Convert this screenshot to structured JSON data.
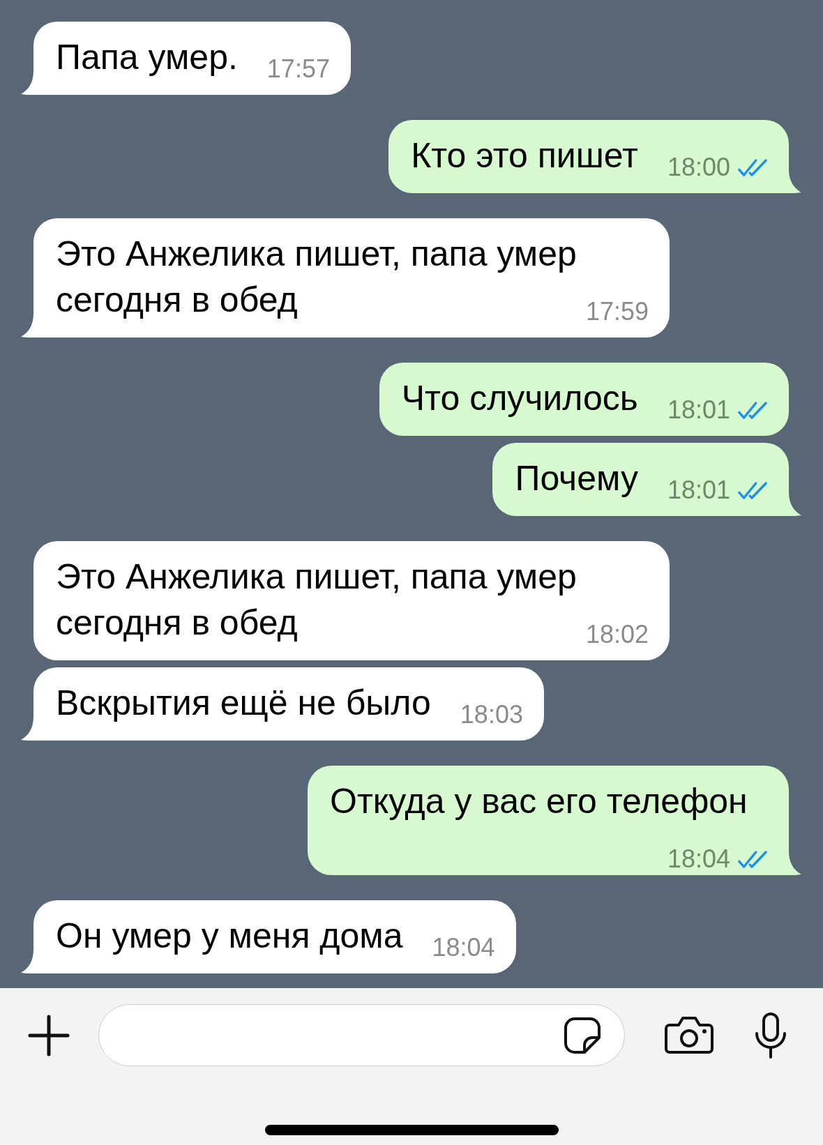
{
  "messages": [
    {
      "kind": "incoming",
      "text": "Папа умер.",
      "time": "17:57",
      "tail": true
    },
    {
      "kind": "outgoing",
      "text": "Кто это пишет",
      "time": "18:00",
      "read": true,
      "tail": true
    },
    {
      "kind": "incoming",
      "text": "Это Анжелика пишет, папа умер сегодня в обед",
      "time": "17:59",
      "tail": true
    },
    {
      "kind": "outgoing",
      "text": "Что случилось",
      "time": "18:01",
      "read": true,
      "tail": false
    },
    {
      "kind": "outgoing",
      "text": "Почему",
      "time": "18:01",
      "read": true,
      "tail": true
    },
    {
      "kind": "incoming",
      "text": "Это Анжелика пишет, папа умер сегодня в обед",
      "time": "18:02",
      "tail": false
    },
    {
      "kind": "incoming",
      "text": "Вскрытия ещё не было",
      "time": "18:03",
      "tail": true
    },
    {
      "kind": "outgoing",
      "text": "Откуда у вас его телефон",
      "time": "18:04",
      "read": true,
      "tail": true
    },
    {
      "kind": "incoming",
      "text": "Он умер у меня дома",
      "time": "18:04",
      "tail": true
    }
  ]
}
